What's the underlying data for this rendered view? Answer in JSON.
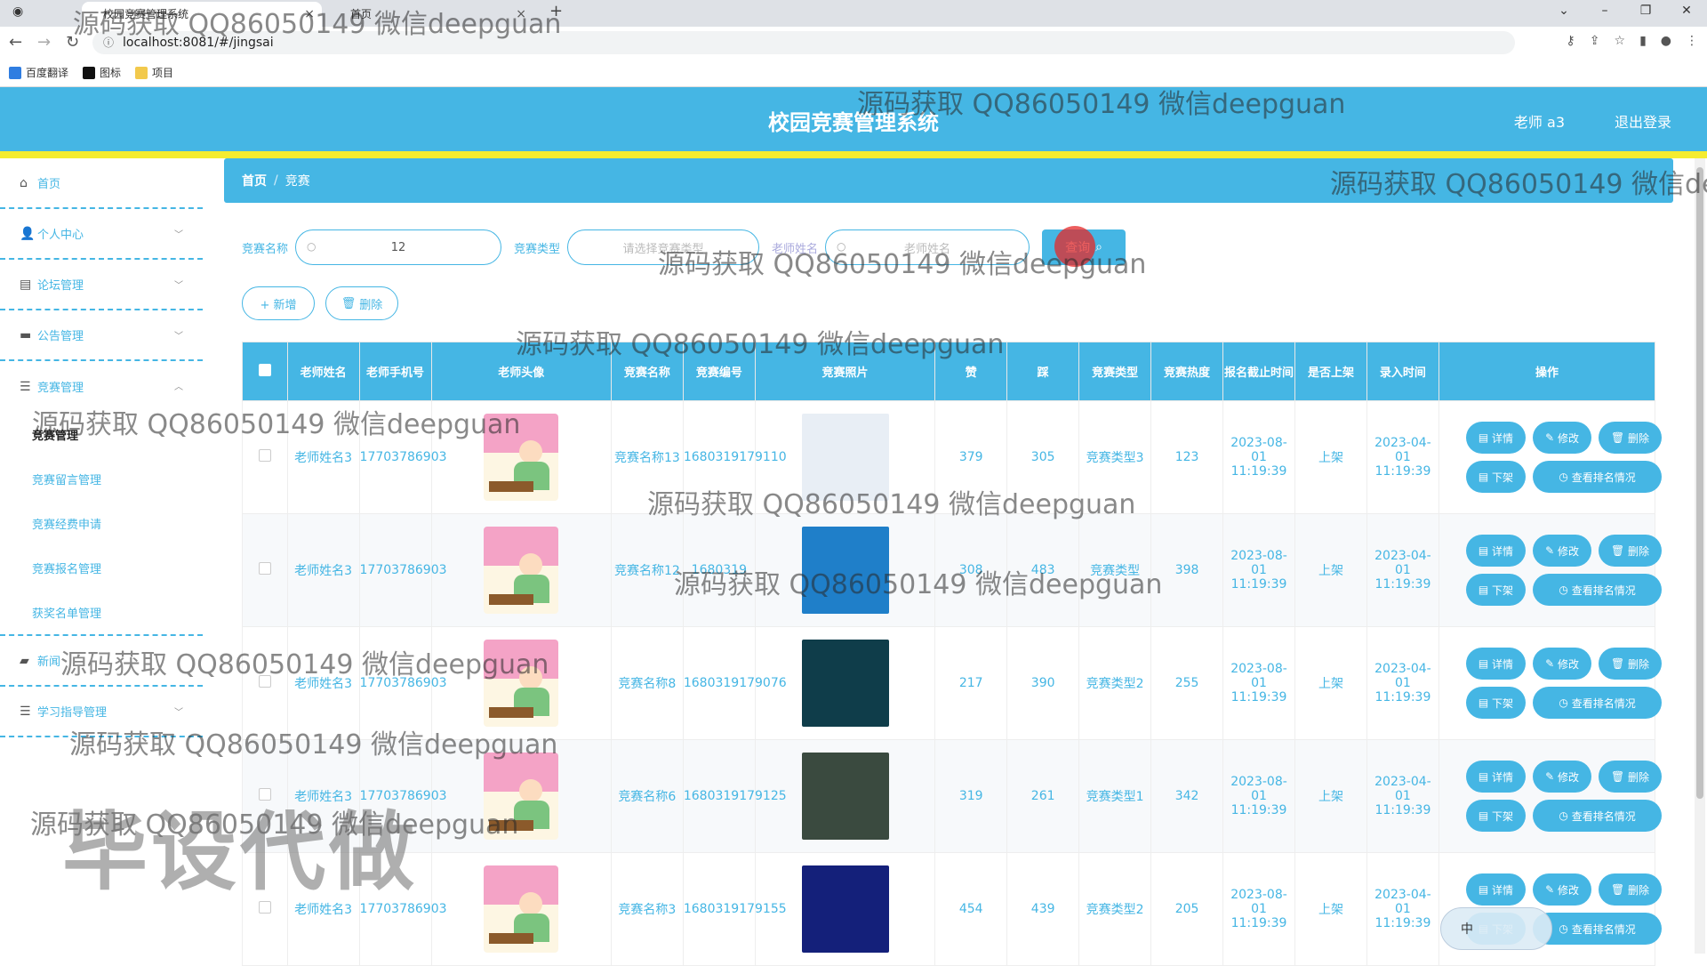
{
  "browser": {
    "tabs": [
      {
        "label": "",
        "active": false
      },
      {
        "label": "校园竞赛管理系统",
        "active": true
      },
      {
        "label": "首页",
        "active": false
      }
    ],
    "url": "localhost:8081/#/jingsai",
    "bookmarks": [
      {
        "label": "百度翻译",
        "color": "#2f7de1"
      },
      {
        "label": "图标",
        "color": "#111111"
      },
      {
        "label": "项目",
        "color": "#f2c94c"
      }
    ]
  },
  "header": {
    "title": "校园竞赛管理系统",
    "user": "老师 a3",
    "logout": "退出登录"
  },
  "sidebar": {
    "items": [
      {
        "label": "首页",
        "icon": "home-icon"
      },
      {
        "label": "个人中心",
        "icon": "user-icon"
      },
      {
        "label": "论坛管理",
        "icon": "forum-icon"
      },
      {
        "label": "公告管理",
        "icon": "notice-icon"
      },
      {
        "label": "竞赛管理",
        "icon": "list-icon"
      }
    ],
    "sub_items": [
      "竞赛管理",
      "竞赛留言管理",
      "竞赛经费申请",
      "竞赛报名管理",
      "获奖名单管理"
    ],
    "items_after": [
      {
        "label": "新闻",
        "icon": "news-icon"
      },
      {
        "label": "学习指导管理",
        "icon": "list-icon"
      }
    ]
  },
  "breadcrumb": {
    "home": "首页",
    "separator": "/",
    "current": "竞赛"
  },
  "search": {
    "name_label": "竞赛名称",
    "name_value": "12",
    "type_label": "竞赛类型",
    "type_placeholder": "请选择竞赛类型",
    "teacher_label": "老师姓名",
    "teacher_placeholder": "老师姓名",
    "button": "查询"
  },
  "actions": {
    "add": "+ 新增",
    "delete": "删除"
  },
  "table": {
    "headers": [
      "老师姓名",
      "老师手机号",
      "老师头像",
      "竞赛名称",
      "竞赛编号",
      "竞赛照片",
      "赞",
      "踩",
      "竞赛类型",
      "竞赛热度",
      "报名截止时间",
      "是否上架",
      "录入时间",
      "操作"
    ],
    "ops": {
      "detail": "详情",
      "edit": "修改",
      "delete": "删除",
      "down": "下架",
      "rank": "查看排名情况"
    },
    "rows": [
      {
        "teacher": "老师姓名3",
        "phone": "17703786903",
        "name": "竞赛名称13",
        "code": "1680319179110",
        "photo_color": "#e8eef5",
        "like": "379",
        "dislike": "305",
        "type": "竞赛类型3",
        "heat": "123",
        "deadline": "2023-08-01 11:19:39",
        "status": "上架",
        "created": "2023-04-01 11:19:39"
      },
      {
        "teacher": "老师姓名3",
        "phone": "17703786903",
        "name": "竞赛名称12",
        "code": "1680319",
        "photo_color": "#1f7fc9",
        "like": "308",
        "dislike": "483",
        "type": "竞赛类型",
        "heat": "398",
        "deadline": "2023-08-01 11:19:39",
        "status": "上架",
        "created": "2023-04-01 11:19:39"
      },
      {
        "teacher": "老师姓名3",
        "phone": "17703786903",
        "name": "竞赛名称8",
        "code": "1680319179076",
        "photo_color": "#0f3d4a",
        "like": "217",
        "dislike": "390",
        "type": "竞赛类型2",
        "heat": "255",
        "deadline": "2023-08-01 11:19:39",
        "status": "上架",
        "created": "2023-04-01 11:19:39"
      },
      {
        "teacher": "老师姓名3",
        "phone": "17703786903",
        "name": "竞赛名称6",
        "code": "1680319179125",
        "photo_color": "#3a4a3f",
        "like": "319",
        "dislike": "261",
        "type": "竞赛类型1",
        "heat": "342",
        "deadline": "2023-08-01 11:19:39",
        "status": "上架",
        "created": "2023-04-01 11:19:39"
      },
      {
        "teacher": "老师姓名3",
        "phone": "17703786903",
        "name": "竞赛名称3",
        "code": "1680319179155",
        "photo_color": "#14207a",
        "like": "454",
        "dislike": "439",
        "type": "竞赛类型2",
        "heat": "205",
        "deadline": "2023-08-01 11:19:39",
        "status": "上架",
        "created": "2023-04-01 11:19:39"
      }
    ]
  },
  "watermarks": {
    "text": "源码获取 QQ86050149 微信deepguan",
    "big": "毕设代做"
  },
  "ime": "中"
}
